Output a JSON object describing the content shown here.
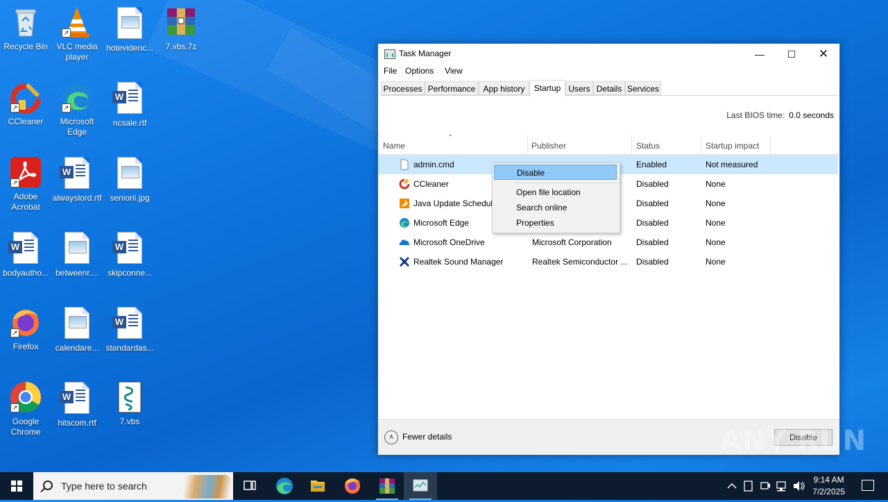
{
  "desktop": {
    "icons": [
      {
        "label": "Recycle Bin"
      },
      {
        "label": "VLC media player"
      },
      {
        "label": "hotevidenc..."
      },
      {
        "label": "7.vbs.7z"
      },
      {
        "label": "CCleaner"
      },
      {
        "label": "Microsoft Edge"
      },
      {
        "label": "ncsale.rtf"
      },
      {
        "label": "Adobe Acrobat"
      },
      {
        "label": "alwayslord.rtf"
      },
      {
        "label": "seniorii.jpg"
      },
      {
        "label": "bodyautho..."
      },
      {
        "label": "betweenr...."
      },
      {
        "label": "skipconne..."
      },
      {
        "label": "Firefox"
      },
      {
        "label": "calendare..."
      },
      {
        "label": "standardas..."
      },
      {
        "label": "Google Chrome"
      },
      {
        "label": "hitscom.rtf"
      },
      {
        "label": "7.vbs"
      }
    ]
  },
  "taskmanager": {
    "title": "Task Manager",
    "menu": [
      "File",
      "Options",
      "View"
    ],
    "tabs": [
      "Processes",
      "Performance",
      "App history",
      "Startup",
      "Users",
      "Details",
      "Services"
    ],
    "active_tab": "Startup",
    "bios_label": "Last BIOS time:",
    "bios_value": "0.0 seconds",
    "columns": [
      "Name",
      "Publisher",
      "Status",
      "Startup impact"
    ],
    "rows": [
      {
        "name": "admin.cmd",
        "publisher": "",
        "status": "Enabled",
        "impact": "Not measured",
        "icon": "cmd-file-icon"
      },
      {
        "name": "CCleaner",
        "publisher": "",
        "status": "Disabled",
        "impact": "None",
        "icon": "ccleaner-icon"
      },
      {
        "name": "Java Update Scheduler",
        "publisher": "",
        "status": "Disabled",
        "impact": "None",
        "icon": "java-icon"
      },
      {
        "name": "Microsoft Edge",
        "publisher": "",
        "status": "Disabled",
        "impact": "None",
        "icon": "edge-icon"
      },
      {
        "name": "Microsoft OneDrive",
        "publisher": "Microsoft Corporation",
        "status": "Disabled",
        "impact": "None",
        "icon": "onedrive-icon"
      },
      {
        "name": "Realtek Sound Manager",
        "publisher": "Realtek Semiconductor ...",
        "status": "Disabled",
        "impact": "None",
        "icon": "realtek-icon"
      }
    ],
    "footer": {
      "fewer_details": "Fewer details",
      "disable_button": "Disable"
    }
  },
  "context_menu": {
    "items": [
      "Disable",
      "Open file location",
      "Search online",
      "Properties"
    ],
    "highlighted": "Disable"
  },
  "taskbar": {
    "search_placeholder": "Type here to search",
    "time": "9:14 AM",
    "date": "7/2/2025"
  },
  "watermark": "ANY RUN"
}
